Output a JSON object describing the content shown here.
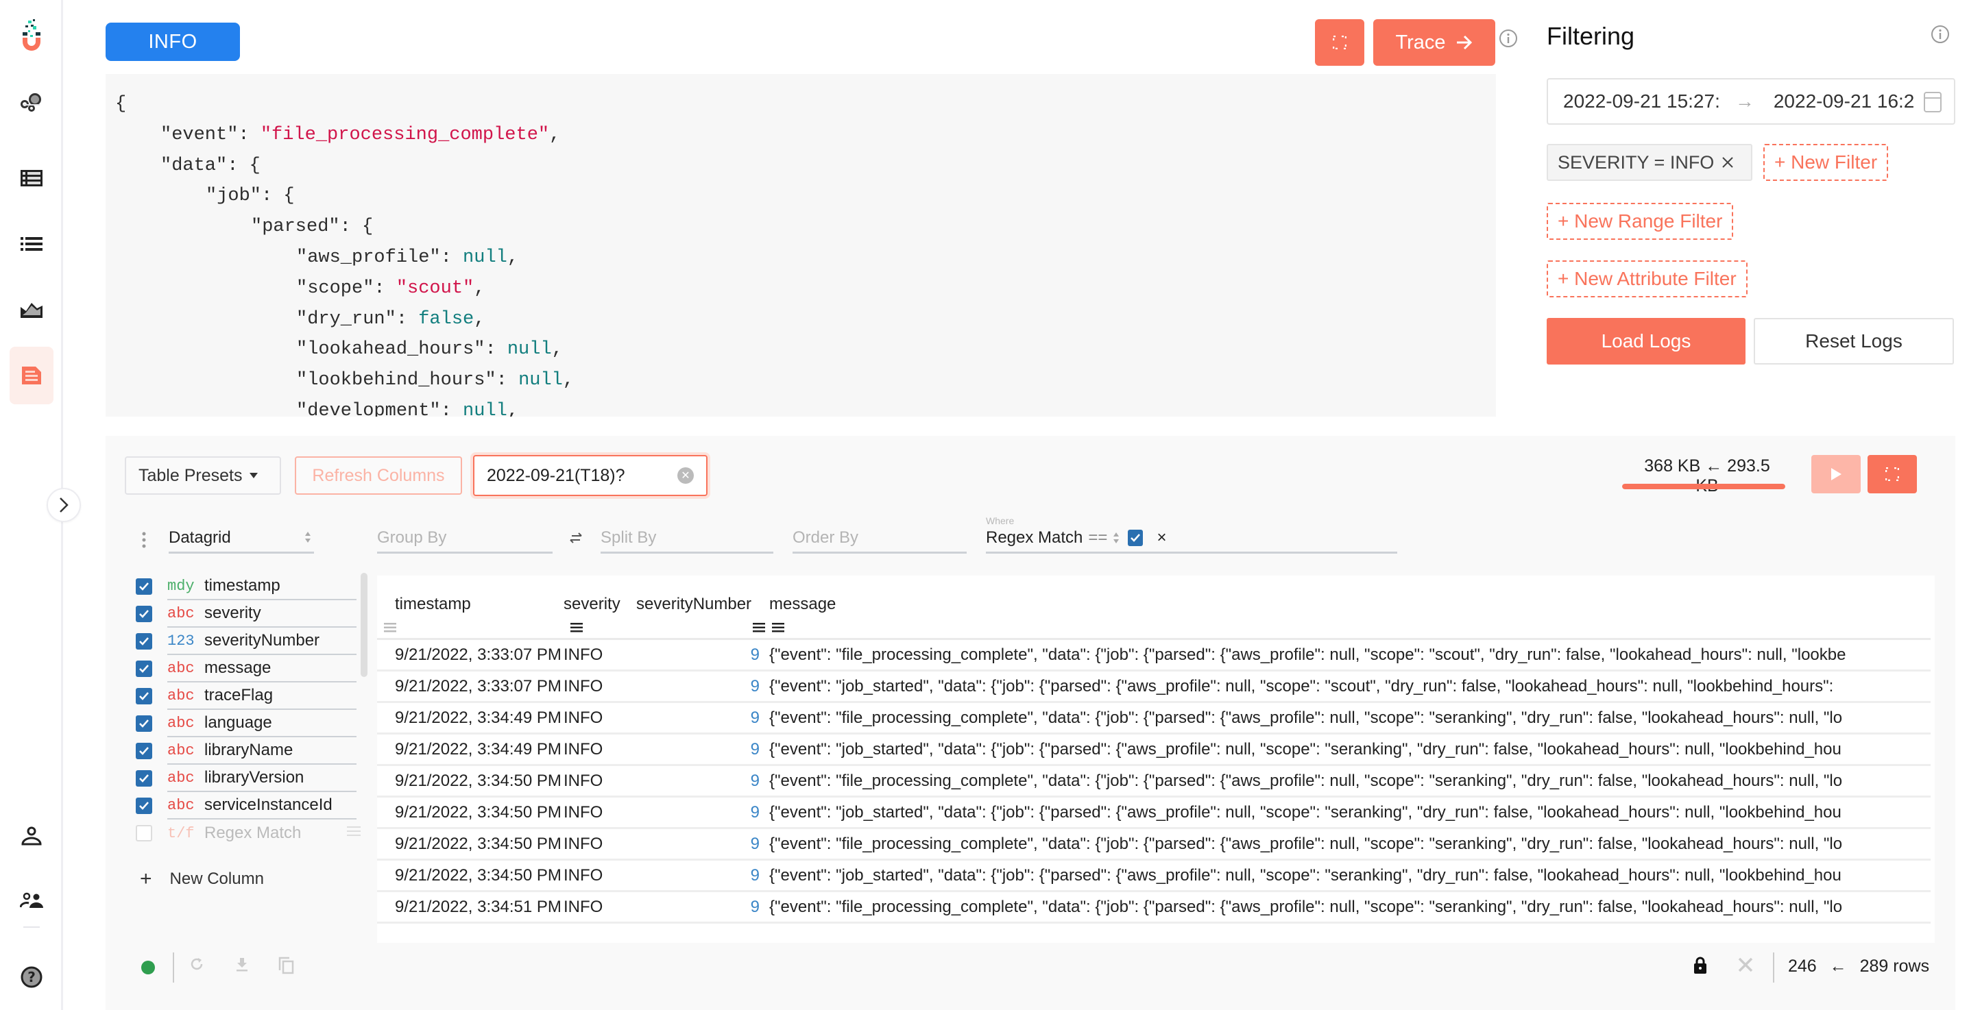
{
  "nav": {
    "logo": "magnet-logo",
    "items": [
      {
        "icon": "bubbles-icon",
        "label": "Overview"
      },
      {
        "icon": "table-list-icon",
        "label": "Tables"
      },
      {
        "icon": "list-icon",
        "label": "Lists"
      },
      {
        "icon": "area-chart-icon",
        "label": "Charts"
      },
      {
        "icon": "document-icon",
        "label": "Logs",
        "active": true
      }
    ],
    "bottom_items": [
      {
        "icon": "user-icon",
        "label": "Profile"
      },
      {
        "icon": "users-icon",
        "label": "Team"
      },
      {
        "icon": "help-icon",
        "label": "Help"
      }
    ],
    "toggle": "chevron-right-icon"
  },
  "detail": {
    "severity_label": "INFO",
    "severity_color": "#2481ee",
    "trace_label": "Trace",
    "json_lines": [
      {
        "indent": 0,
        "parts": [
          {
            "t": "{",
            "c": "p"
          }
        ]
      },
      {
        "indent": 1,
        "parts": [
          {
            "t": "\"event\": ",
            "c": "p"
          },
          {
            "t": "\"file_processing_complete\"",
            "c": "str"
          },
          {
            "t": ",",
            "c": "p"
          }
        ]
      },
      {
        "indent": 1,
        "parts": [
          {
            "t": "\"data\": {",
            "c": "p"
          }
        ]
      },
      {
        "indent": 2,
        "parts": [
          {
            "t": "\"job\": {",
            "c": "p"
          }
        ]
      },
      {
        "indent": 3,
        "parts": [
          {
            "t": "\"parsed\": {",
            "c": "p"
          }
        ]
      },
      {
        "indent": 4,
        "parts": [
          {
            "t": "\"aws_profile\": ",
            "c": "p"
          },
          {
            "t": "null",
            "c": "lit"
          },
          {
            "t": ",",
            "c": "p"
          }
        ]
      },
      {
        "indent": 4,
        "parts": [
          {
            "t": "\"scope\": ",
            "c": "p"
          },
          {
            "t": "\"scout\"",
            "c": "str"
          },
          {
            "t": ",",
            "c": "p"
          }
        ]
      },
      {
        "indent": 4,
        "parts": [
          {
            "t": "\"dry_run\": ",
            "c": "p"
          },
          {
            "t": "false",
            "c": "lit"
          },
          {
            "t": ",",
            "c": "p"
          }
        ]
      },
      {
        "indent": 4,
        "parts": [
          {
            "t": "\"lookahead_hours\": ",
            "c": "p"
          },
          {
            "t": "null",
            "c": "lit"
          },
          {
            "t": ",",
            "c": "p"
          }
        ]
      },
      {
        "indent": 4,
        "parts": [
          {
            "t": "\"lookbehind_hours\": ",
            "c": "p"
          },
          {
            "t": "null",
            "c": "lit"
          },
          {
            "t": ",",
            "c": "p"
          }
        ]
      },
      {
        "indent": 4,
        "parts": [
          {
            "t": "\"development\": ",
            "c": "p"
          },
          {
            "t": "null",
            "c": "lit"
          },
          {
            "t": ",",
            "c": "p"
          }
        ]
      }
    ]
  },
  "filtering": {
    "title": "Filtering",
    "date_from": "2022-09-21 15:27:",
    "date_to": "2022-09-21 16:2",
    "active_filter": "SEVERITY = INFO",
    "new_filter_label": "+ New Filter",
    "new_range_filter_label": "+ New Range Filter",
    "new_attribute_filter_label": "+ New Attribute Filter",
    "load_label": "Load Logs",
    "reset_label": "Reset Logs",
    "accent": "#f9735b"
  },
  "grid": {
    "presets_label": "Table Presets",
    "refresh_label": "Refresh Columns",
    "search_value": "2022-09-21(T18)?",
    "size_readout": "368 KB ← 293.5 KB",
    "size_progress": 1.0,
    "plugin": "Datagrid",
    "group_by_placeholder": "Group By",
    "split_by_placeholder": "Split By",
    "order_by_placeholder": "Order By",
    "where_label": "Where",
    "where_column": "Regex Match",
    "where_op": "==",
    "where_value_checked": true,
    "columns": [
      {
        "type": "mdy",
        "type_class": "mdy",
        "name": "timestamp",
        "checked": true
      },
      {
        "type": "abc",
        "type_class": "abc",
        "name": "severity",
        "checked": true
      },
      {
        "type": "123",
        "type_class": "num",
        "name": "severityNumber",
        "checked": true
      },
      {
        "type": "abc",
        "type_class": "abc",
        "name": "message",
        "checked": true
      },
      {
        "type": "abc",
        "type_class": "abc",
        "name": "traceFlag",
        "checked": true
      },
      {
        "type": "abc",
        "type_class": "abc",
        "name": "language",
        "checked": true
      },
      {
        "type": "abc",
        "type_class": "abc",
        "name": "libraryName",
        "checked": true
      },
      {
        "type": "abc",
        "type_class": "abc",
        "name": "libraryVersion",
        "checked": true
      },
      {
        "type": "abc",
        "type_class": "abc",
        "name": "serviceInstanceId",
        "checked": true
      },
      {
        "type": "t/f",
        "type_class": "tf",
        "name": "Regex Match",
        "checked": false
      }
    ],
    "new_column_label": "New Column",
    "table": {
      "headers": [
        "timestamp",
        "severity",
        "severityNumber",
        "message"
      ],
      "rows": [
        [
          "9/21/2022, 3:33:07 PM",
          "INFO",
          "9",
          "{\"event\": \"file_processing_complete\", \"data\": {\"job\": {\"parsed\": {\"aws_profile\": null, \"scope\": \"scout\", \"dry_run\": false, \"lookahead_hours\": null, \"lookbe"
        ],
        [
          "9/21/2022, 3:33:07 PM",
          "INFO",
          "9",
          "{\"event\": \"job_started\", \"data\": {\"job\": {\"parsed\": {\"aws_profile\": null, \"scope\": \"scout\", \"dry_run\": false, \"lookahead_hours\": null, \"lookbehind_hours\": "
        ],
        [
          "9/21/2022, 3:34:49 PM",
          "INFO",
          "9",
          "{\"event\": \"file_processing_complete\", \"data\": {\"job\": {\"parsed\": {\"aws_profile\": null, \"scope\": \"seranking\", \"dry_run\": false, \"lookahead_hours\": null, \"lo"
        ],
        [
          "9/21/2022, 3:34:49 PM",
          "INFO",
          "9",
          "{\"event\": \"job_started\", \"data\": {\"job\": {\"parsed\": {\"aws_profile\": null, \"scope\": \"seranking\", \"dry_run\": false, \"lookahead_hours\": null, \"lookbehind_hou"
        ],
        [
          "9/21/2022, 3:34:50 PM",
          "INFO",
          "9",
          "{\"event\": \"file_processing_complete\", \"data\": {\"job\": {\"parsed\": {\"aws_profile\": null, \"scope\": \"seranking\", \"dry_run\": false, \"lookahead_hours\": null, \"lo"
        ],
        [
          "9/21/2022, 3:34:50 PM",
          "INFO",
          "9",
          "{\"event\": \"job_started\", \"data\": {\"job\": {\"parsed\": {\"aws_profile\": null, \"scope\": \"seranking\", \"dry_run\": false, \"lookahead_hours\": null, \"lookbehind_hou"
        ],
        [
          "9/21/2022, 3:34:50 PM",
          "INFO",
          "9",
          "{\"event\": \"file_processing_complete\", \"data\": {\"job\": {\"parsed\": {\"aws_profile\": null, \"scope\": \"seranking\", \"dry_run\": false, \"lookahead_hours\": null, \"lo"
        ],
        [
          "9/21/2022, 3:34:50 PM",
          "INFO",
          "9",
          "{\"event\": \"job_started\", \"data\": {\"job\": {\"parsed\": {\"aws_profile\": null, \"scope\": \"seranking\", \"dry_run\": false, \"lookahead_hours\": null, \"lookbehind_hou"
        ],
        [
          "9/21/2022, 3:34:51 PM",
          "INFO",
          "9",
          "{\"event\": \"file_processing_complete\", \"data\": {\"job\": {\"parsed\": {\"aws_profile\": null, \"scope\": \"seranking\", \"dry_run\": false, \"lookahead_hours\": null, \"lo"
        ]
      ]
    },
    "footer": {
      "status": "connected",
      "status_color": "#2f9e4f",
      "rows_shown": "246",
      "rows_total": "289 rows"
    }
  }
}
